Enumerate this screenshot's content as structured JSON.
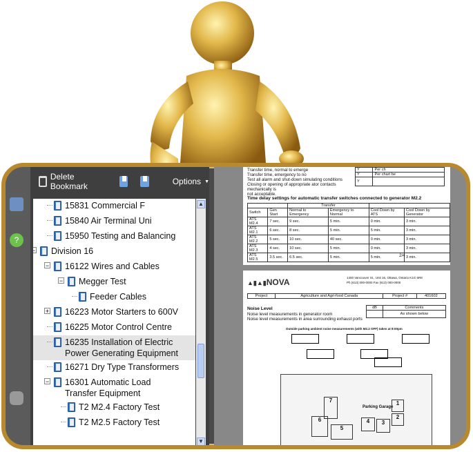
{
  "toolbar": {
    "delete_label": "Delete Bookmark",
    "options_label": "Options"
  },
  "bookmarks": [
    {
      "label": "15831 Commercial F",
      "level": 1,
      "book": true
    },
    {
      "label": "15840 Air Terminal Uni",
      "level": 1,
      "book": true
    },
    {
      "label": "15950 Testing and Balancing",
      "level": 1,
      "book": true
    },
    {
      "label": "Division 16",
      "level": 0,
      "book": true,
      "toggle": "−"
    },
    {
      "label": "16122 Wires and Cables",
      "level": 1,
      "book": true,
      "toggle": "−"
    },
    {
      "label": "Megger Test",
      "level": 2,
      "book": true,
      "toggle": "−"
    },
    {
      "label": "Feeder Cables",
      "level": 3,
      "book": true
    },
    {
      "label": "16223 Motor Starters to 600V",
      "level": 1,
      "book": true,
      "toggle": "+"
    },
    {
      "label": "16225 Motor Control Centre",
      "level": 1,
      "book": true
    },
    {
      "label": "16235 Installation of Electric",
      "label2": "Power Generating Equipment",
      "level": 1,
      "book": true,
      "selected": true
    },
    {
      "label": "16271 Dry Type Transformers",
      "level": 1,
      "book": true
    },
    {
      "label": "16301 Automatic Load",
      "label2": "Transfer Equipment",
      "level": 1,
      "book": true,
      "toggle": "−"
    },
    {
      "label": "T2 M2.4 Factory Test",
      "level": 2,
      "book": true
    },
    {
      "label": "T2 M2.5 Factory Test",
      "level": 2,
      "book": true
    }
  ],
  "page1": {
    "lines": [
      "Transfer time, normal to emerge",
      "Transfer time, emergency to no",
      "Test all alarm and shut-down             simulating conditions",
      "Closing or opening of appropriate        ator contacts mechanically is",
      "not acceptable."
    ],
    "right_cells": [
      [
        "Y",
        "Per ch"
      ],
      [
        "Y",
        "Per chart be"
      ],
      [
        "Y",
        ""
      ]
    ],
    "heading": "Time delay settings for automatic transfer switches connected to generator M2.2",
    "table_group": "Transfer",
    "table_head": [
      "Switch",
      "Gen Start",
      "Normal to Emergency",
      "Emergency to Normal",
      "Cool Down by ATS",
      "Cool Down by Generator"
    ],
    "table_rows": [
      [
        "ATS M2.4",
        "7 sec.",
        "9 sec.",
        "5 min.",
        "0 min.",
        "3 min."
      ],
      [
        "ATS M2.1",
        "6 sec.",
        "8 sec.",
        "5 min.",
        "5 min.",
        "3 min."
      ],
      [
        "ATS M2.2",
        "5 sec.",
        "10 sec.",
        "40 sec.",
        "0 min.",
        "3 min."
      ],
      [
        "ATS M2.3",
        "4 sec.",
        "10 sec.",
        "5 min.",
        "0 min.",
        "3 min."
      ],
      [
        "ATS M2.5",
        "3.5 sec.",
        "6.5 sec.",
        "5 min.",
        "5 min.",
        "3 min."
      ]
    ],
    "page_num": "2/4"
  },
  "page2": {
    "brand": "NOVA",
    "address": "1400 Vancouver St., Unit 16, Ottawa, Ontario K1G 6R8",
    "phone": "Ph (613) 000-0000   Fax (613) 000-0000",
    "header_cells": [
      "Project",
      "Agriculture and Agri-food Canada",
      "Project #",
      "401602"
    ],
    "col_db": "dB",
    "col_comments": "Comments",
    "title": "Noise Level",
    "row1": "Noise level measurements in generator room",
    "row2": "Noise level measurements in area surrounding exhaust ports",
    "as_shown": "As shown below",
    "caption": "Outside parking ambient noise measurements (with M2.2 OFF) taken at 8:00pm",
    "map_label": "Parking Garage",
    "map_numbers": [
      "1",
      "2",
      "3",
      "4",
      "5",
      "6",
      "7"
    ]
  },
  "colors": {
    "frame": "#b8892e",
    "panel": "#3f3f3f",
    "selected": "#e4e4e4",
    "book_icon": "#3c72c4"
  }
}
